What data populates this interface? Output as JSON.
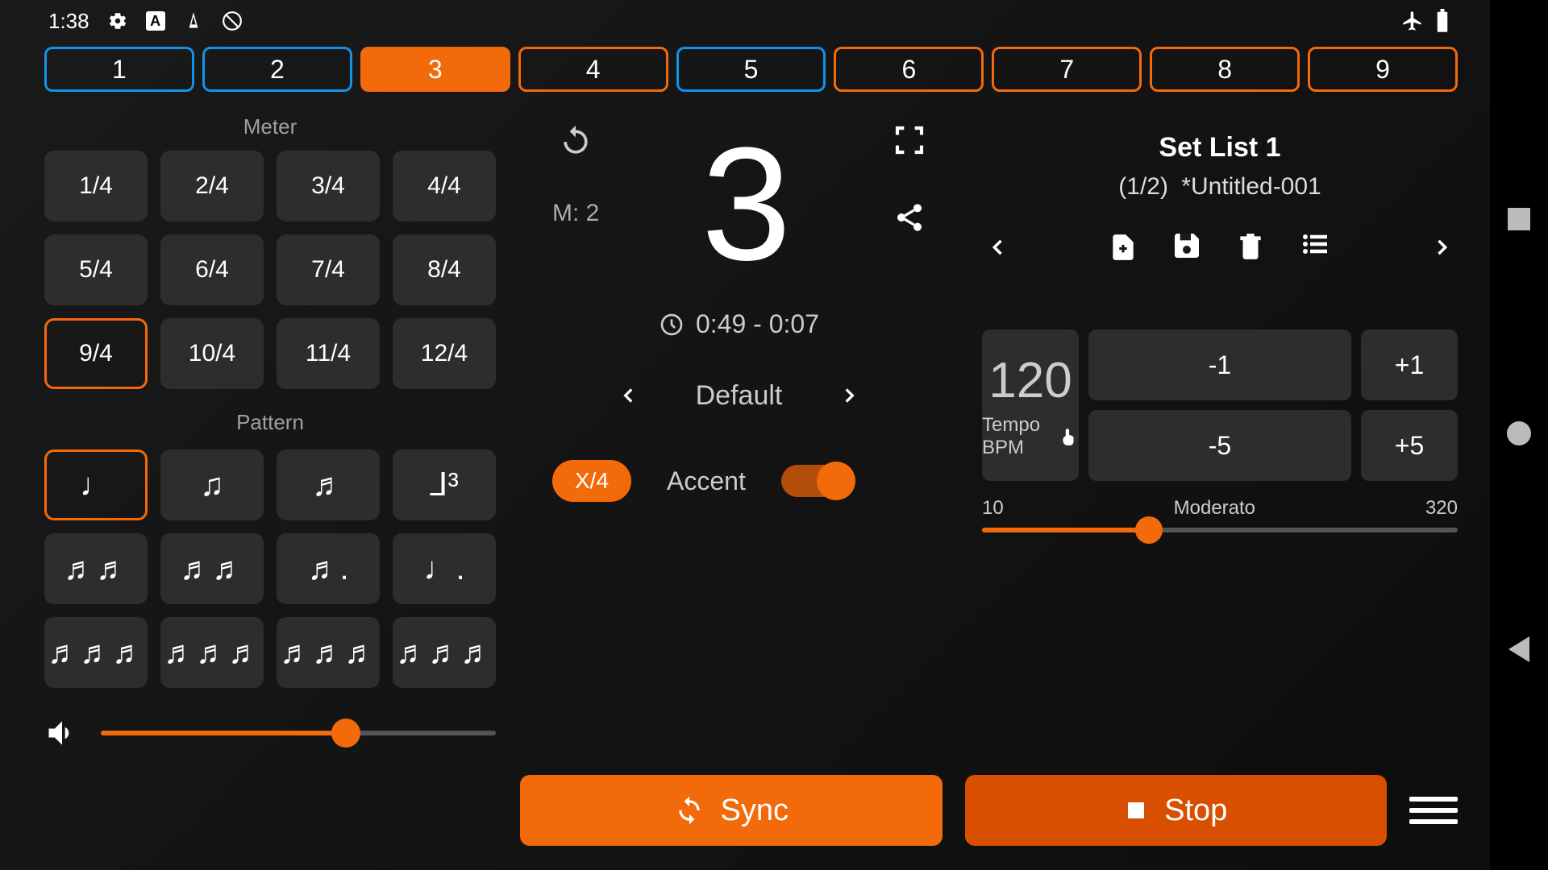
{
  "status": {
    "time": "1:38"
  },
  "beats": {
    "items": [
      "1",
      "2",
      "3",
      "4",
      "5",
      "6",
      "7",
      "8",
      "9"
    ],
    "blue": [
      0,
      1,
      4
    ],
    "active": 2
  },
  "meter": {
    "label": "Meter",
    "items": [
      "1/4",
      "2/4",
      "3/4",
      "4/4",
      "5/4",
      "6/4",
      "7/4",
      "8/4",
      "9/4",
      "10/4",
      "11/4",
      "12/4"
    ],
    "selected": 8
  },
  "pattern": {
    "label": "Pattern",
    "items": [
      "♩",
      "♫",
      "♬",
      "⅃³",
      "♬♬",
      "♬♬",
      "♬.",
      "♩.",
      "♬♬♬",
      "♬♬♬",
      "♬♬♬",
      "♬♬♬"
    ],
    "selected": 0
  },
  "volume": {
    "pct": 62
  },
  "center": {
    "m_label": "M: 2",
    "counter": "3",
    "timer": "0:49 - 0:07",
    "preset": "Default",
    "x4": "X/4",
    "accent_label": "Accent"
  },
  "setlist": {
    "title": "Set List 1",
    "position": "(1/2)",
    "song": "*Untitled-001"
  },
  "tempo": {
    "minus1": "-1",
    "plus1": "+1",
    "minus5": "-5",
    "plus5": "+5",
    "value": "120",
    "label": "Tempo BPM",
    "min": "10",
    "max": "320",
    "word": "Moderato",
    "pct": 35
  },
  "buttons": {
    "sync": "Sync",
    "stop": "Stop"
  }
}
